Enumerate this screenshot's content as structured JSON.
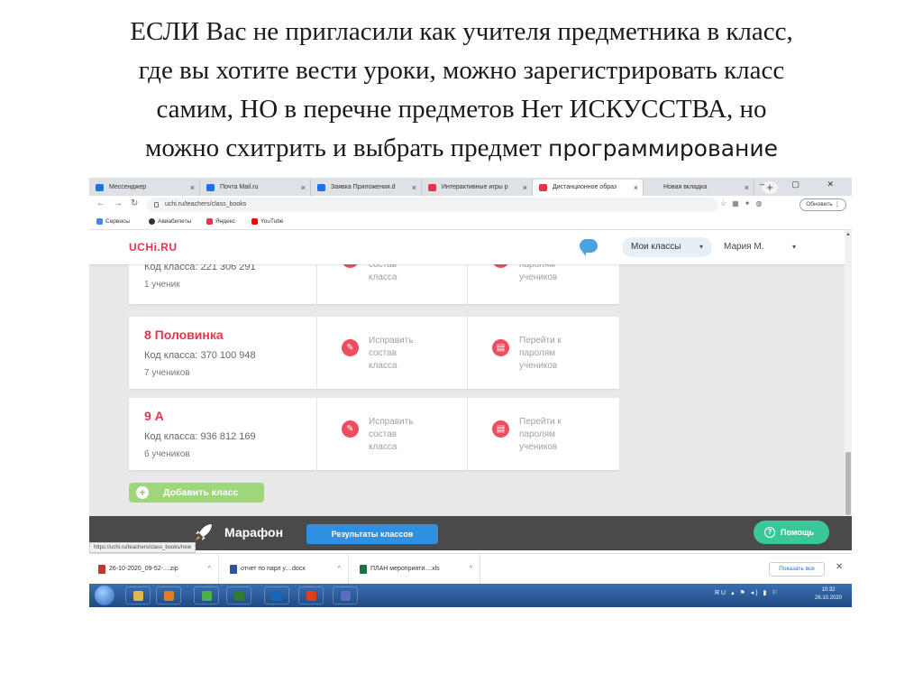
{
  "slide": {
    "title_lines": [
      "ЕСЛИ Вас не пригласили как учителя предметника в класс,",
      "где вы хотите вести уроки, можно зарегистрировать класс",
      "самим, НО  в перечне предметов Нет ИСКУССТВА, но",
      "можно схитрить  и выбрать предмет "
    ],
    "title_tail": "программирование"
  },
  "browser": {
    "tabs": [
      {
        "label": "Мессенджер",
        "color": "#1a73e8"
      },
      {
        "label": "Почта Mail.ru",
        "color": "#1a73e8"
      },
      {
        "label": "Заявка Приложения.d",
        "color": "#1a73e8"
      },
      {
        "label": "Интерактивные игры р",
        "color": "#e8334a"
      },
      {
        "label": "Дистанционное образ",
        "color": "#e8334a"
      },
      {
        "label": "Новая вкладка",
        "color": "#9aa0a6"
      }
    ],
    "url": "uchi.ru/teachers/class_books",
    "update_label": "Обновить",
    "bookmarks": [
      "Сервисы",
      "Авиабилеты",
      "Яндекс",
      "YouTube"
    ]
  },
  "site": {
    "logo": "UCHi.RU",
    "my_classes": "Мои классы",
    "user": "Мария М.",
    "classes": [
      {
        "name": "",
        "code": "Код класса: 221 306 291",
        "count": "1 ученик"
      },
      {
        "name": "8 Половинка",
        "code": "Код класса: 370 100 948",
        "count": "7 учеников"
      },
      {
        "name": "9 А",
        "code": "Код класса: 936 812 169",
        "count": "6 учеников"
      }
    ],
    "edit_lines": [
      "Исправить",
      "состав",
      "класса"
    ],
    "pass_lines": [
      "Перейти к",
      "паролям",
      "учеников"
    ],
    "add_class": "Добавить класс",
    "marathon": "Марафон",
    "results": "Результаты классов",
    "help": "Помощь",
    "status_url": "https://uchi.ru/teachers/class_books/new"
  },
  "downloads": {
    "items": [
      {
        "name": "26-10-2020_09-52-....zip",
        "color": "#c0392b"
      },
      {
        "name": "отчет по парл у....docx",
        "color": "#2b5797"
      },
      {
        "name": "ПЛАН мероприяти....xls",
        "color": "#1e7145"
      }
    ],
    "show_all": "Показать все"
  },
  "taskbar": {
    "lang": "RU",
    "time": "10:32",
    "date": "26.10.2020",
    "app_colors": [
      "#e0b84a",
      "#e07b28",
      "#4caf50",
      "#2e7d32",
      "#1565c0",
      "#d84315",
      "#5c6bc0"
    ]
  }
}
